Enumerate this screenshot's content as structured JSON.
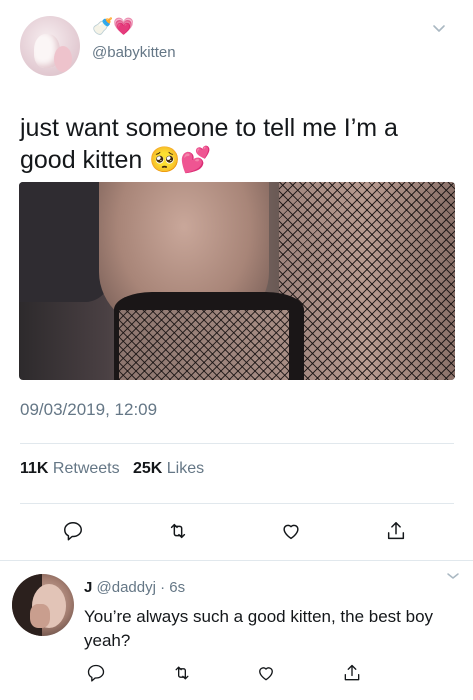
{
  "tweet": {
    "author_emojis": "🍼💗",
    "handle": "@babykitten",
    "text": "just want someone to tell me I’m a good kitten 🥺💕",
    "timestamp": "09/03/2019, 12:09",
    "retweet_count": "11K",
    "retweet_label": "Retweets",
    "like_count": "25K",
    "like_label": "Likes"
  },
  "reply": {
    "name": "J",
    "handle": "@daddyj",
    "separator": "·",
    "time": "6s",
    "text": "You’re always such a good kitten, the best boy yeah?"
  },
  "icons": {
    "reply": "reply-icon",
    "retweet": "retweet-icon",
    "like": "heart-icon",
    "share": "share-icon",
    "more": "chevron-down-icon"
  },
  "colors": {
    "text": "#14171a",
    "secondary": "#657786",
    "divider": "#e1e8ed"
  }
}
